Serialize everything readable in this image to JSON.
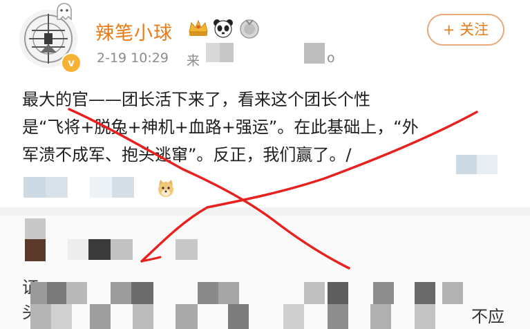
{
  "post": {
    "username": "辣笔小球",
    "time": "2-19 10:29",
    "source_prefix": "来",
    "source_suffix": "o",
    "follow_label": "+ 关注",
    "verified_mark": "v",
    "text_lines": [
      "最大的官——团长活下来了，看来这个团长个性",
      "是“飞将+脱兔+神机+血路+强运”。在此基础上，“外",
      "军溃不成军、抱头逃窜”。反正，我们赢了。/"
    ],
    "badges": [
      "crown-badge",
      "panda-badge",
      "medal-badge"
    ]
  },
  "comments": {
    "fragment_left": "证",
    "fragment_left2": "头",
    "fragment_right": "不应"
  },
  "overlay": {
    "color": "#e8211f"
  }
}
